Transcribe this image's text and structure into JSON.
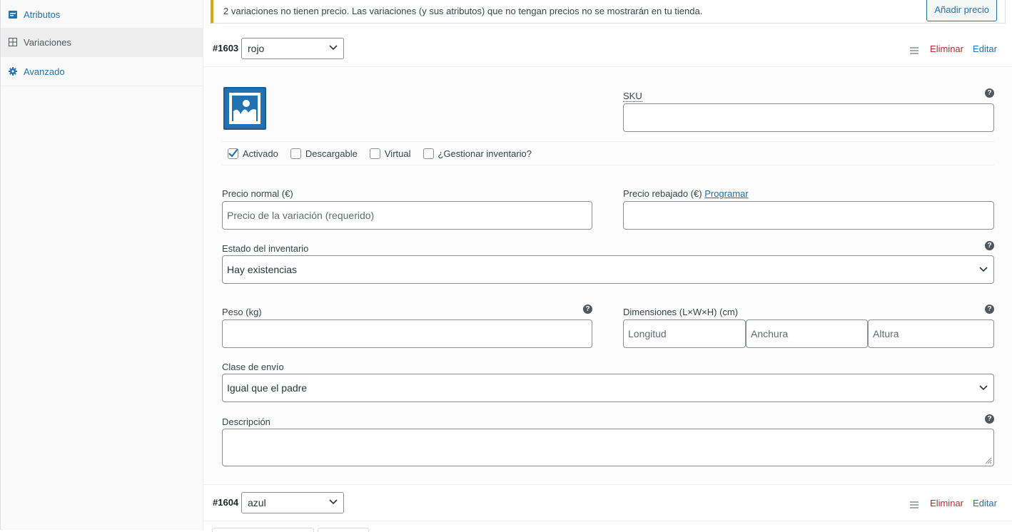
{
  "sidebar": {
    "items": [
      {
        "label": "Atributos",
        "icon": "list-icon",
        "active": false
      },
      {
        "label": "Variaciones",
        "icon": "grid-icon",
        "active": true
      },
      {
        "label": "Avanzado",
        "icon": "gear-icon",
        "active": false
      }
    ]
  },
  "notice": {
    "text": "2 variaciones no tienen precio. Las variaciones (y sus atributos) que no tengan precios no se mostrarán en tu tienda.",
    "button_label": "Añadir precio",
    "accent_color": "#dba617"
  },
  "variations": [
    {
      "id": "#1603",
      "attribute_value": "rojo",
      "delete_label": "Eliminar",
      "edit_label": "Editar"
    },
    {
      "id": "#1604",
      "attribute_value": "azul",
      "delete_label": "Eliminar",
      "edit_label": "Editar"
    }
  ],
  "form": {
    "sku_label": "SKU",
    "sku_value": "",
    "checkboxes": [
      {
        "label": "Activado",
        "checked": true
      },
      {
        "label": "Descargable",
        "checked": false
      },
      {
        "label": "Virtual",
        "checked": false
      },
      {
        "label": "¿Gestionar inventario?",
        "checked": false
      }
    ],
    "regular_price_label": "Precio normal (€)",
    "regular_price_placeholder": "Precio de la variación (requerido)",
    "sale_price_label": "Precio rebajado (€)",
    "sale_price_link": "Programar",
    "stock_status_label": "Estado del inventario",
    "stock_status_value": "Hay existencias",
    "weight_label": "Peso (kg)",
    "dimensions_label": "Dimensiones (L×W×H) (cm)",
    "length_placeholder": "Longitud",
    "width_placeholder": "Anchura",
    "height_placeholder": "Altura",
    "shipping_class_label": "Clase de envío",
    "shipping_class_value": "Igual que el padre",
    "description_label": "Descripción"
  },
  "colors": {
    "link": "#2271b1",
    "delete": "#b32d2e"
  }
}
